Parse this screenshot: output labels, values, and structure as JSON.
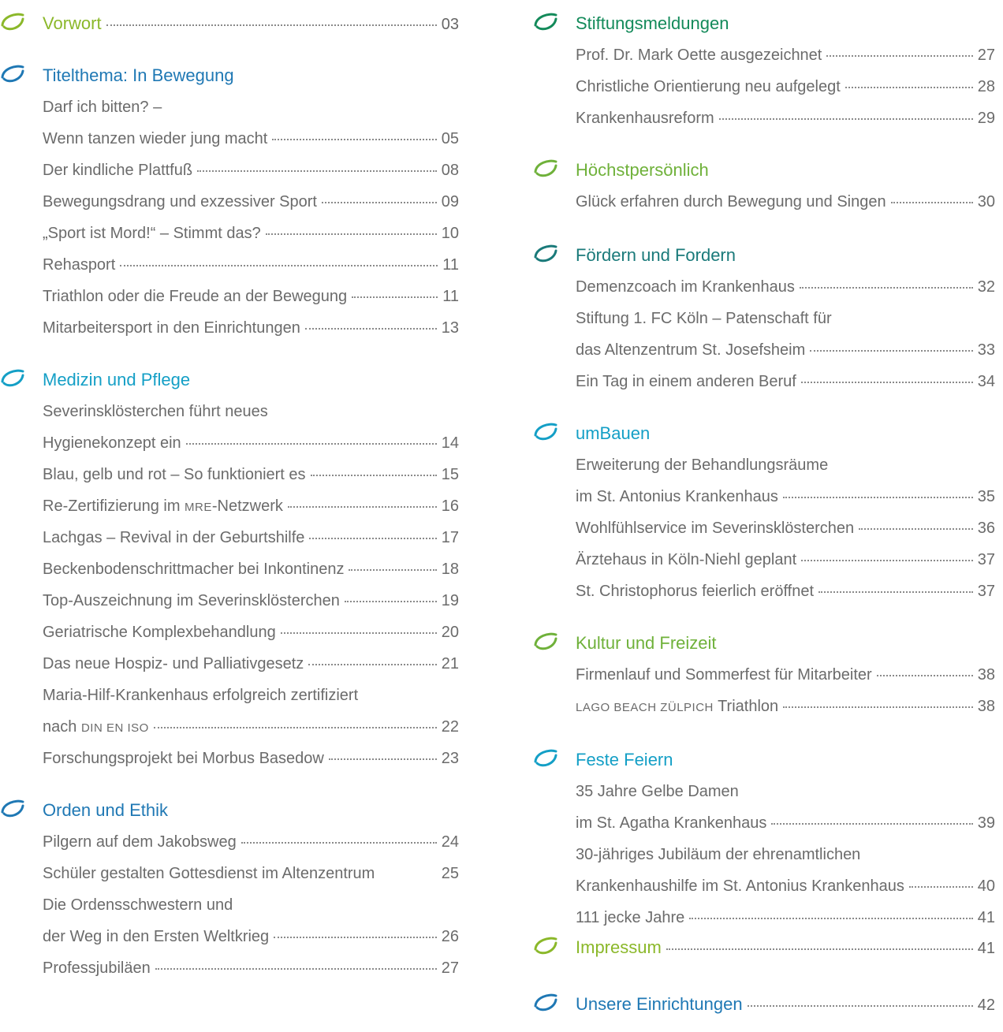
{
  "colors": {
    "lime": "#8bb82a",
    "blue": "#1f78b4",
    "cyan": "#149fc6",
    "teal": "#1a7a7a",
    "green": "#138a5a",
    "lightgreen": "#6fb13a",
    "text": "#6b6b6b"
  },
  "left": {
    "vorwort": {
      "title": "Vorwort",
      "page": "03"
    },
    "titelthema": {
      "title": "Titelthema: In Bewegung",
      "entries": [
        {
          "title": "Darf ich bitten? –",
          "page": ""
        },
        {
          "title": "Wenn tanzen wieder jung macht",
          "page": "05"
        },
        {
          "title": "Der kindliche Plattfuß",
          "page": "08"
        },
        {
          "title": "Bewegungsdrang und exzessiver Sport",
          "page": "09"
        },
        {
          "title": "„Sport ist Mord!“ – Stimmt das?",
          "page": "10"
        },
        {
          "title": "Rehasport",
          "page": "11"
        },
        {
          "title": "Triathlon oder die Freude an der Bewegung",
          "page": "11"
        },
        {
          "title": "Mitarbeitersport in den Einrichtungen",
          "page": "13"
        }
      ]
    },
    "medizin": {
      "title": "Medizin und Pflege",
      "entries": [
        {
          "title": "Severinsklösterchen führt neues",
          "page": ""
        },
        {
          "title": "Hygienekonzept ein",
          "page": "14"
        },
        {
          "title": "Blau, gelb und rot – So funktioniert es",
          "page": "15"
        },
        {
          "title_pre": "Re-Zertifizierung im ",
          "title_sc": "MRE",
          "title_post": "-Netzwerk",
          "page": "16"
        },
        {
          "title": "Lachgas – Revival in der Geburtshilfe",
          "page": "17"
        },
        {
          "title": "Beckenbodenschrittmacher bei Inkontinenz",
          "page": "18"
        },
        {
          "title": "Top-Auszeichnung im Severinsklösterchen",
          "page": "19"
        },
        {
          "title": "Geriatrische Komplexbehandlung",
          "page": "20"
        },
        {
          "title": "Das neue Hospiz- und Palliativgesetz",
          "page": "21"
        },
        {
          "title": "Maria-Hilf-Krankenhaus erfolgreich zertifiziert",
          "page": ""
        },
        {
          "title_pre": "nach ",
          "title_sc": "DIN EN ISO",
          "title_post": "",
          "page": "22"
        },
        {
          "title": "Forschungsprojekt bei Morbus Basedow",
          "page": "23"
        }
      ]
    },
    "orden": {
      "title": "Orden und Ethik",
      "entries": [
        {
          "title": "Pilgern auf dem Jakobsweg",
          "page": "24"
        },
        {
          "title": "Schüler gestalten Gottesdienst im Altenzentrum",
          "page": "25"
        },
        {
          "title": "Die Ordensschwestern und",
          "page": ""
        },
        {
          "title": "der Weg in den Ersten Weltkrieg",
          "page": "26"
        },
        {
          "title": "Professjubiläen",
          "page": "27"
        }
      ]
    }
  },
  "right": {
    "stiftung": {
      "title": "Stiftungsmeldungen",
      "entries": [
        {
          "title": "Prof. Dr. Mark Oette ausgezeichnet",
          "page": "27"
        },
        {
          "title": "Christliche Orientierung neu aufgelegt",
          "page": "28"
        },
        {
          "title": "Krankenhausreform",
          "page": "29"
        }
      ]
    },
    "hoechst": {
      "title": "Höchstpersönlich",
      "entries": [
        {
          "title": "Glück erfahren durch Bewegung und Singen",
          "page": "30"
        }
      ]
    },
    "foerdern": {
      "title": "Fördern und Fordern",
      "entries": [
        {
          "title": "Demenzcoach im Krankenhaus",
          "page": "32"
        },
        {
          "title": "Stiftung 1. FC Köln – Patenschaft für",
          "page": ""
        },
        {
          "title": "das Altenzentrum St. Josefsheim",
          "page": "33"
        },
        {
          "title": "Ein Tag in einem anderen Beruf",
          "page": "34"
        }
      ]
    },
    "umbauen": {
      "title": "umBauen",
      "entries": [
        {
          "title": "Erweiterung der Behandlungsräume",
          "page": ""
        },
        {
          "title": "im St. Antonius Krankenhaus",
          "page": "35"
        },
        {
          "title": "Wohlfühlservice im Severinsklösterchen",
          "page": "36"
        },
        {
          "title": "Ärztehaus in Köln-Niehl geplant",
          "page": "37"
        },
        {
          "title": "St. Christophorus feierlich eröffnet",
          "page": "37"
        }
      ]
    },
    "kultur": {
      "title": "Kultur und Freizeit",
      "entries": [
        {
          "title": "Firmenlauf und Sommerfest für Mitarbeiter",
          "page": "38"
        },
        {
          "title_pre": "",
          "title_sc": "LAGO BEACH ZÜLPICH",
          "title_post": " Triathlon",
          "page": "38"
        }
      ]
    },
    "feste": {
      "title": "Feste Feiern",
      "entries": [
        {
          "title": "35 Jahre Gelbe Damen",
          "page": ""
        },
        {
          "title": "im St. Agatha Krankenhaus",
          "page": "39"
        },
        {
          "title": "30-jähriges Jubiläum der ehrenamtlichen",
          "page": ""
        },
        {
          "title": "Krankenhaushilfe im St. Antonius Krankenhaus",
          "page": "40"
        },
        {
          "title": "111 jecke Jahre",
          "page": "41"
        }
      ]
    },
    "impressum": {
      "title": "Impressum",
      "page": "41"
    },
    "einrichtungen": {
      "title": "Unsere Einrichtungen",
      "page": "42"
    }
  }
}
